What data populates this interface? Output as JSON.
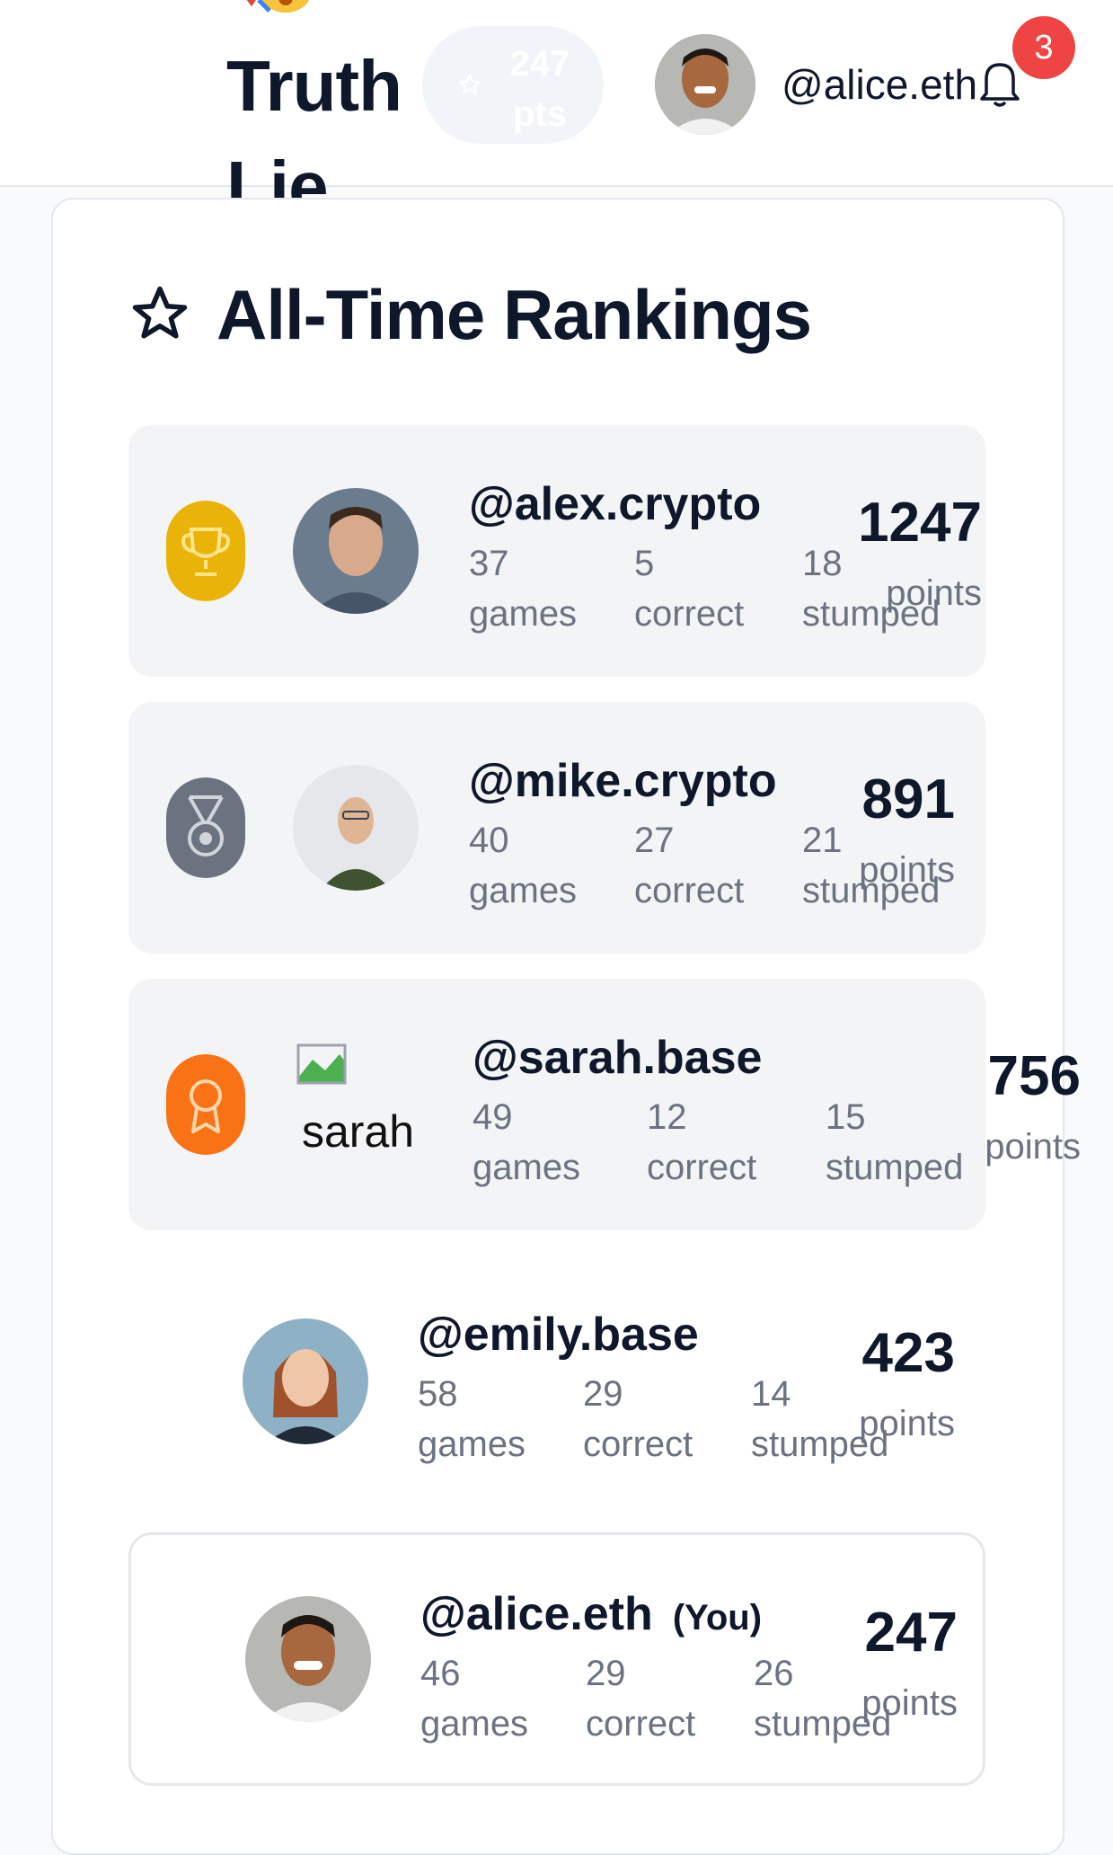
{
  "header": {
    "brand": "Truth Lie",
    "points_pill": "247 pts",
    "username": "@alice.eth",
    "notification_count": "3"
  },
  "leaderboard": {
    "title": "All-Time Rankings",
    "players": [
      {
        "username": "@alex.crypto",
        "games": "37",
        "games_label": "games",
        "correct": "5",
        "correct_label": "correct",
        "stumped": "18",
        "stumped_label": "stumped",
        "score": "1247",
        "score_label": "points",
        "medal": "gold-trophy-icon"
      },
      {
        "username": "@mike.crypto",
        "games": "40",
        "games_label": "games",
        "correct": "27",
        "correct_label": "correct",
        "stumped": "21",
        "stumped_label": "stumped",
        "score": "891",
        "score_label": "points",
        "medal": "silver-medal-icon"
      },
      {
        "username": "@sarah.base",
        "games": "49",
        "games_label": "games",
        "correct": "12",
        "correct_label": "correct",
        "stumped": "15",
        "stumped_label": "stumped",
        "score": "756",
        "score_label": "points",
        "medal": "bronze-award-icon",
        "avatar_alt": "sarah"
      },
      {
        "username": "@emily.base",
        "games": "58",
        "games_label": "games",
        "correct": "29",
        "correct_label": "correct",
        "stumped": "14",
        "stumped_label": "stumped",
        "score": "423",
        "score_label": "points"
      },
      {
        "username": "@alice.eth",
        "you_tag": "(You)",
        "games": "46",
        "games_label": "games",
        "correct": "29",
        "correct_label": "correct",
        "stumped": "26",
        "stumped_label": "stumped",
        "score": "247",
        "score_label": "points"
      }
    ]
  },
  "colors": {
    "gold": "#eab308",
    "silver": "#6b7280",
    "bronze": "#f97316",
    "notification": "#ef4444"
  }
}
